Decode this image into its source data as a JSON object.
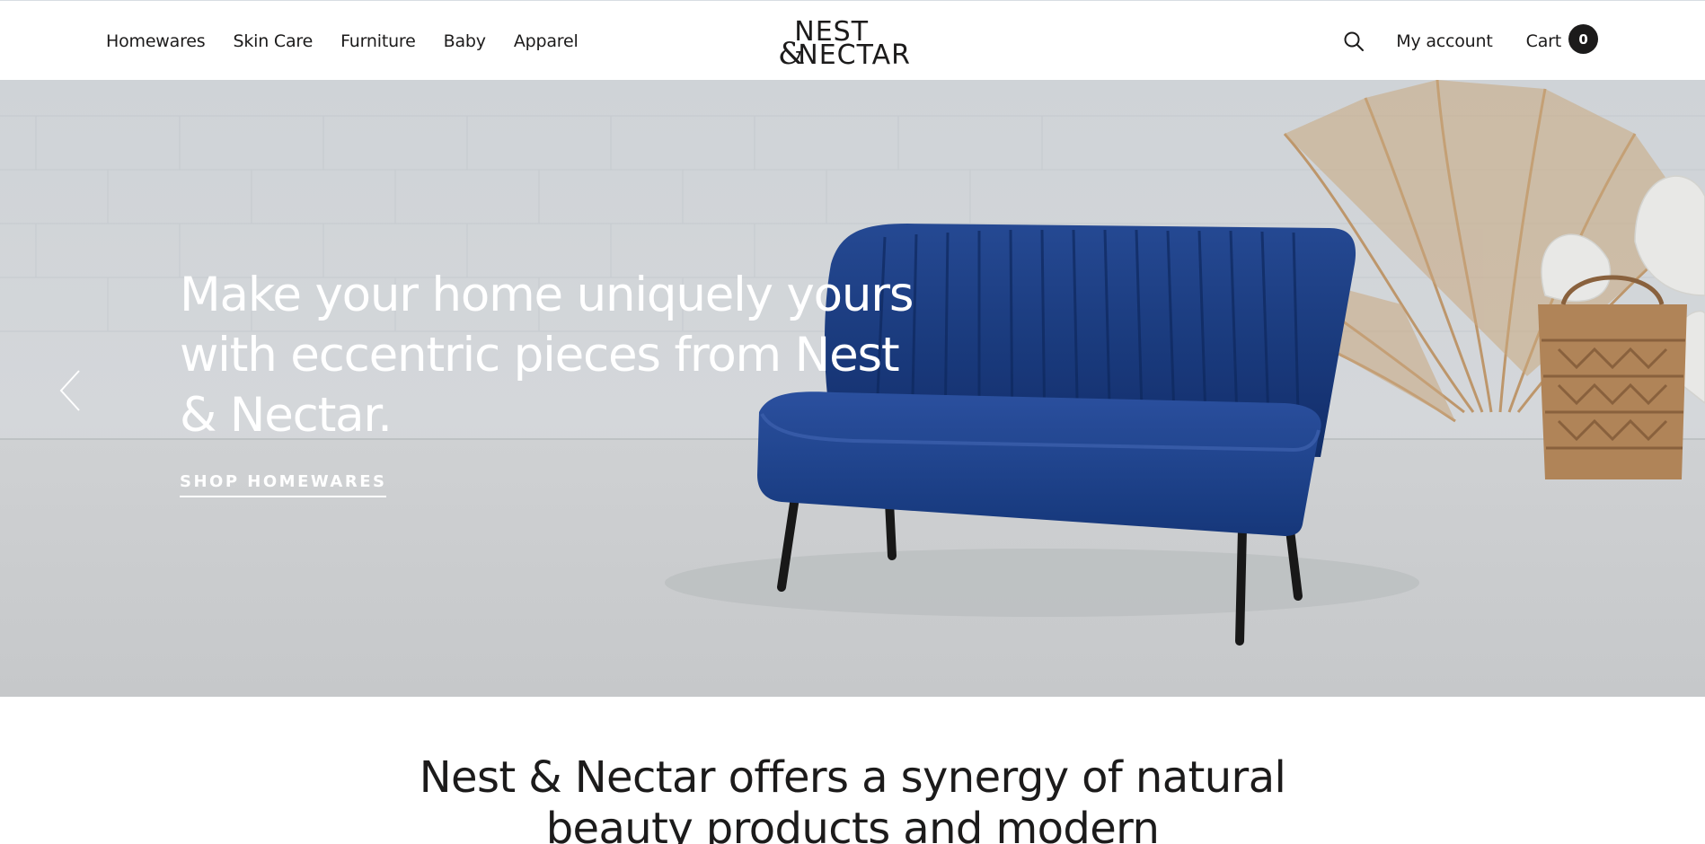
{
  "header": {
    "nav": [
      "Homewares",
      "Skin Care",
      "Furniture",
      "Baby",
      "Apparel"
    ],
    "logo": {
      "line1": "NEST",
      "line2": "NECTAR",
      "amp": "&"
    },
    "search_icon": "search-icon",
    "account_label": "My account",
    "cart_label": "Cart",
    "cart_count": "0"
  },
  "hero": {
    "heading": "Make your home uniquely yours with eccentric pieces from Nest & Nectar.",
    "cta": "SHOP HOMEWARES",
    "prev_icon": "chevron-left-icon",
    "image": "blue-velvet-loveseat-with-dried-palm-leaves"
  },
  "intro": {
    "heading": "Nest & Nectar offers a synergy of natural beauty products and modern"
  },
  "colors": {
    "text": "#1c1b1b",
    "hero_bg": "#dcdfe2",
    "sofa_blue": "#1e3f8a",
    "dried_leaves": "#c9a57a"
  }
}
